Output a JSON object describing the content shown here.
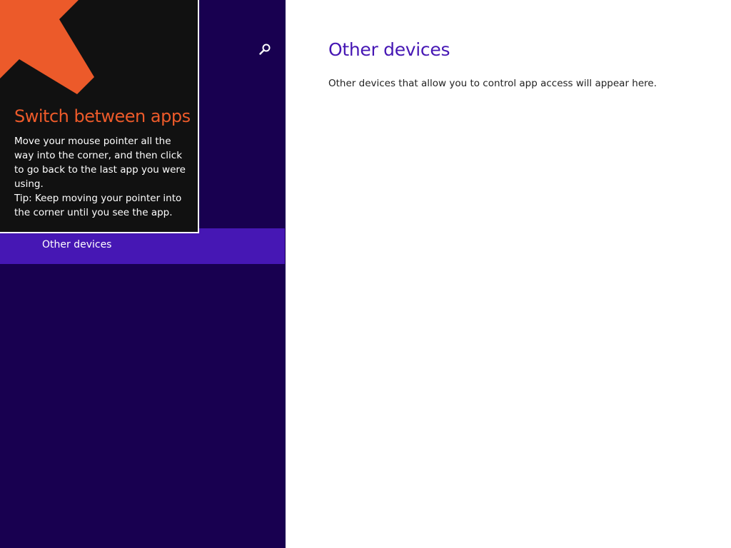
{
  "sidebar": {
    "search_icon": "search-icon",
    "items": [
      {
        "label": "Other devices",
        "selected": true
      }
    ]
  },
  "tip": {
    "icon": "arrow-up-left-icon",
    "title": "Switch between apps",
    "body_line1": "Move your mouse pointer all the way into the corner, and then click to go back to the last app you were using.",
    "body_line2": "Tip: Keep moving your pointer into the corner until you see the app."
  },
  "main": {
    "title": "Other devices",
    "description": "Other devices that allow you to control app access will appear here."
  },
  "colors": {
    "sidebar_bg": "#180050",
    "selected_item_bg": "#4617b4",
    "accent": "#4617b4",
    "tip_bg": "#111111",
    "tip_accent": "#ec5a2a"
  }
}
